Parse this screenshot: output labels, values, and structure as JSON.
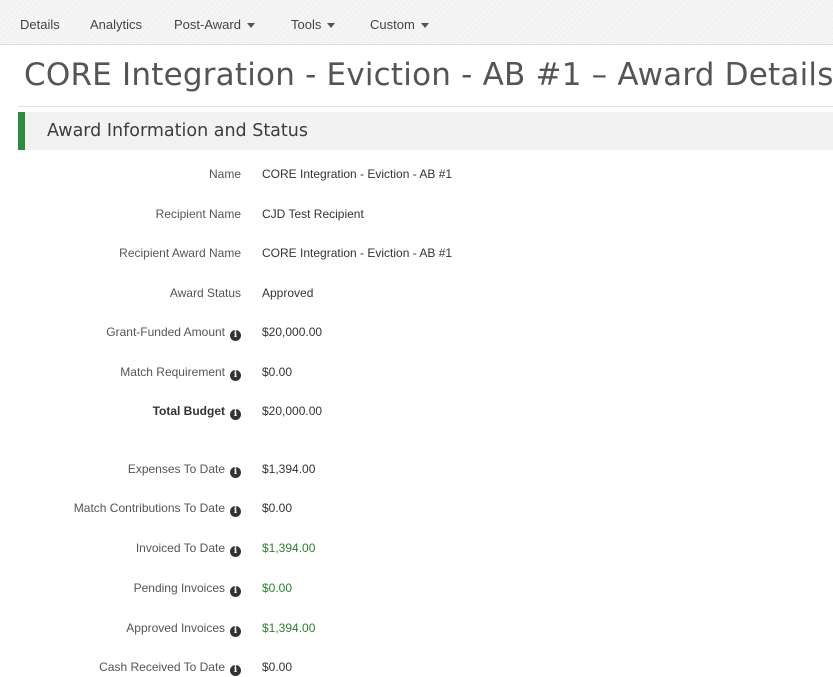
{
  "nav": {
    "items": [
      {
        "label": "Details",
        "dropdown": false
      },
      {
        "label": "Analytics",
        "dropdown": false
      },
      {
        "label": "Post-Award",
        "dropdown": true
      },
      {
        "label": "Tools",
        "dropdown": true
      },
      {
        "label": "Custom",
        "dropdown": true
      }
    ]
  },
  "page": {
    "title": "CORE Integration - Eviction - AB #1 – Award Details"
  },
  "section": {
    "title": "Award Information and Status",
    "accent_color": "#2e8b3e"
  },
  "fields": [
    {
      "label": "Name",
      "value": "CORE Integration - Eviction - AB #1",
      "info": false,
      "bold": false,
      "green": false
    },
    {
      "label": "Recipient Name",
      "value": "CJD Test Recipient",
      "info": false,
      "bold": false,
      "green": false
    },
    {
      "label": "Recipient Award Name",
      "value": "CORE Integration - Eviction - AB #1",
      "info": false,
      "bold": false,
      "green": false
    },
    {
      "label": "Award Status",
      "value": "Approved",
      "info": false,
      "bold": false,
      "green": false
    },
    {
      "label": "Grant-Funded Amount",
      "value": "$20,000.00",
      "info": true,
      "bold": false,
      "green": false
    },
    {
      "label": "Match Requirement",
      "value": "$0.00",
      "info": true,
      "bold": false,
      "green": false
    },
    {
      "label": "Total Budget",
      "value": "$20,000.00",
      "info": true,
      "bold": true,
      "green": false
    },
    {
      "label": "Expenses To Date",
      "value": "$1,394.00",
      "info": true,
      "bold": false,
      "green": false
    },
    {
      "label": "Match Contributions To Date",
      "value": "$0.00",
      "info": true,
      "bold": false,
      "green": false
    },
    {
      "label": "Invoiced To Date",
      "value": "$1,394.00",
      "info": true,
      "bold": false,
      "green": true
    },
    {
      "label": "Pending Invoices",
      "value": "$0.00",
      "info": true,
      "bold": false,
      "green": true
    },
    {
      "label": "Approved Invoices",
      "value": "$1,394.00",
      "info": true,
      "bold": false,
      "green": true
    },
    {
      "label": "Cash Received To Date",
      "value": "$0.00",
      "info": true,
      "bold": false,
      "green": false
    }
  ],
  "icons": {
    "info": "info-circle-icon",
    "dropdown": "caret-down-icon"
  }
}
